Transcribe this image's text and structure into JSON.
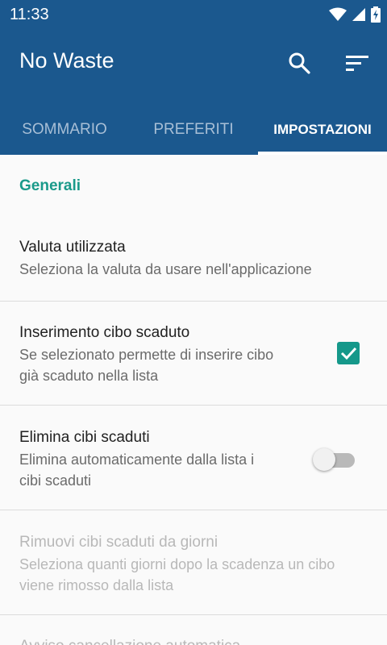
{
  "status_bar": {
    "time": "11:33",
    "icons": [
      "wifi-icon",
      "signal-icon",
      "battery-icon"
    ]
  },
  "app_bar": {
    "title": "No Waste",
    "actions": [
      "search-icon",
      "sort-icon"
    ],
    "background_color": "#1b588e"
  },
  "tabs": [
    {
      "label": "SOMMARIO",
      "selected": false
    },
    {
      "label": "PREFERITI",
      "selected": false
    },
    {
      "label": "IMPOSTAZIONI",
      "selected": true
    }
  ],
  "settings": {
    "section_title": "Generali",
    "accent_color": "#15988a",
    "items": [
      {
        "title": "Valuta utilizzata",
        "summary": "Seleziona la valuta da usare nell'applicazione",
        "control": "none",
        "enabled": true
      },
      {
        "title": "Inserimento cibo scaduto",
        "summary_lines": [
          "Se selezionato permette di inserire cibo",
          "già scaduto nella lista"
        ],
        "control": "checkbox",
        "checked": true,
        "enabled": true
      },
      {
        "title": "Elimina cibi scaduti",
        "summary_lines": [
          "Elimina automaticamente dalla lista i",
          "cibi scaduti"
        ],
        "control": "switch",
        "checked": false,
        "enabled": true
      },
      {
        "title": "Rimuovi cibi scaduti da giorni",
        "summary_lines": [
          "Seleziona quanti giorni dopo la scadenza un cibo",
          "viene rimosso dalla lista"
        ],
        "control": "none",
        "enabled": false
      },
      {
        "title": "Avviso cancellazione automatica",
        "control": "none",
        "enabled": false
      }
    ]
  }
}
